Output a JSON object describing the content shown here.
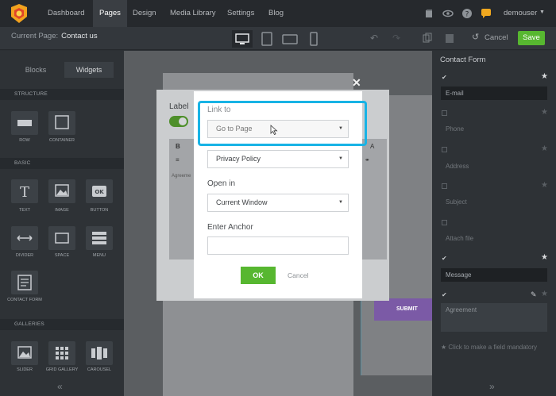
{
  "nav": {
    "items": [
      "Dashboard",
      "Pages",
      "Design",
      "Media Library",
      "Settings",
      "Blog"
    ],
    "active": "Pages",
    "user": "demouser"
  },
  "subbar": {
    "current_page_label": "Current Page:",
    "current_page_value": "Contact us",
    "cancel": "Cancel",
    "save": "Save"
  },
  "left_sidebar": {
    "tabs": [
      "Blocks",
      "Widgets"
    ],
    "active_tab": "Widgets",
    "sections": {
      "structure": "STRUCTURE",
      "basic": "BASIC",
      "galleries": "GALLERIES"
    },
    "widgets": {
      "row": "ROW",
      "container": "CONTAINER",
      "text": "TEXT",
      "image": "IMAGE",
      "button": "BUTTON",
      "divider": "DIVIDER",
      "space": "SPACE",
      "menu": "MENU",
      "contact_form": "CONTACT FORM",
      "slider": "SLIDER",
      "grid_gallery": "GRID GALLERY",
      "carousel": "CAROUSEL"
    }
  },
  "back_panel": {
    "label": "Label",
    "editor_text": "Agreeme",
    "submit": "SUBMIT"
  },
  "right_sidebar": {
    "title": "Contact Form",
    "fields": [
      {
        "label": "E-mail",
        "checked": true,
        "starred": true
      },
      {
        "label": "Phone",
        "checked": false,
        "starred": false
      },
      {
        "label": "Address",
        "checked": false,
        "starred": false
      },
      {
        "label": "Subject",
        "checked": false,
        "starred": false
      },
      {
        "label": "Attach file",
        "checked": false,
        "starred": false
      },
      {
        "label": "Message",
        "checked": true,
        "starred": true
      },
      {
        "label": "Agreement",
        "checked": true,
        "starred": false
      }
    ],
    "hint": "Click to make a field mandatory"
  },
  "modal": {
    "link_to_label": "Link to",
    "link_to_value": "Go to Page",
    "page_value": "Privacy Policy",
    "open_in_label": "Open in",
    "open_in_value": "Current Window",
    "anchor_label": "Enter Anchor",
    "anchor_value": "",
    "ok": "OK",
    "cancel": "Cancel"
  },
  "colors": {
    "accent_green": "#57b730",
    "highlight_blue": "#18b3e5",
    "submit_purple": "#7b5aa6"
  }
}
